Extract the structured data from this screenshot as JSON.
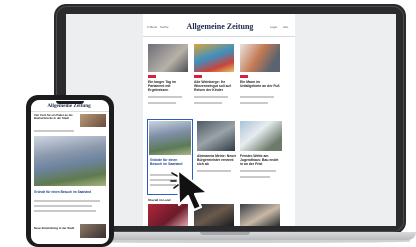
{
  "site": {
    "title": "Allgemeine Zeitung",
    "nav_left": "Menü",
    "nav_search": "Suche",
    "nav_login": "Login",
    "nav_abo": "Abo"
  },
  "colors": {
    "accent_red": "#d9203a",
    "highlight_blue": "#2a5fc4",
    "brand_navy": "#1c2a4a"
  },
  "teasers_row1": [
    {
      "headline": "Ein langer Tag im Parlament mit Ergebnissen"
    },
    {
      "headline": "Alte Weinberge: Ihr Winzerweingut soll auf Reisen der Kinder"
    },
    {
      "headline": "Ein Mann im Unfallgebiete an der Fuß"
    }
  ],
  "teasers_row2": [
    {
      "headline": "Gründe für einen Besuch im Saarland"
    },
    {
      "headline": "Alemannia Meine: Neuer Bürgermeister ernennt sich ab"
    },
    {
      "headline": "Fenster-Wette am Jugendhaus: Bau endet in an der Frist"
    }
  ],
  "section_label": "Überall im Land",
  "phone": {
    "logo": "Allgemeine Zeitung",
    "top_headline": "Vier Cent für ein Paket an die Bücherbrücke in der Stadt",
    "feature_headline": "Gründe für einen Besuch im Saarland",
    "bottom_text": "Neue Entwicklung in der Stadt"
  },
  "cursor": {
    "icon": "arrow-cursor-icon"
  }
}
